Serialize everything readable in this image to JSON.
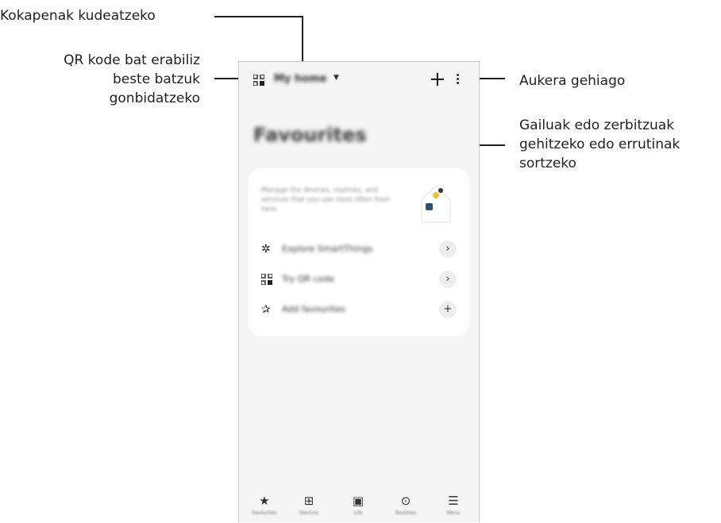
{
  "callouts": {
    "manage_locations": "Kokapenak kudeatzeko",
    "qr_invite_line1": "QR kode bat erabiliz",
    "qr_invite_line2": "beste batzuk",
    "qr_invite_line3": "gonbidatzeko",
    "more_options": "Aukera gehiago",
    "add_line1": "Gailuak edo zerbitzuak",
    "add_line2": "gehitzeko edo errutinak",
    "add_line3": "sortzeko"
  },
  "app": {
    "home_name": "My home",
    "add_symbol": "+",
    "page_title": "Favourites",
    "card": {
      "description": "Manage the devices, routines, and services that you use most often from here."
    },
    "rows": [
      {
        "icon": "smartthings-icon",
        "label": "Explore SmartThings",
        "action": "›"
      },
      {
        "icon": "qr-code-icon",
        "label": "Try QR code",
        "action": "›"
      },
      {
        "icon": "star-outline-icon",
        "label": "Add favourites",
        "action": "+"
      }
    ],
    "nav": [
      {
        "icon": "star-icon",
        "label": "Favourites"
      },
      {
        "icon": "devices-icon",
        "label": "Devices"
      },
      {
        "icon": "life-icon",
        "label": "Life"
      },
      {
        "icon": "routines-icon",
        "label": "Routines"
      },
      {
        "icon": "menu-icon",
        "label": "Menu"
      }
    ]
  }
}
